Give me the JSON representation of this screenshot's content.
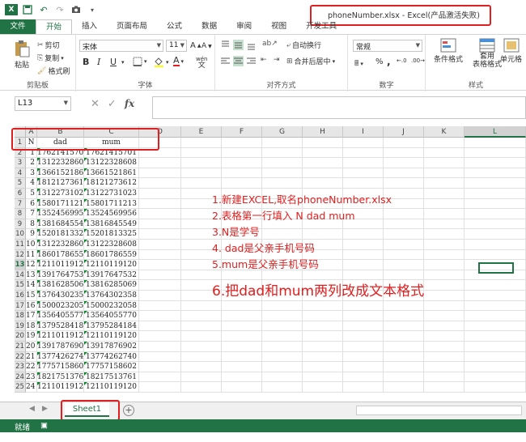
{
  "window": {
    "title": "phoneNumber.xlsx - Excel(产品激活失败)"
  },
  "ribbon_tabs": [
    "文件",
    "开始",
    "插入",
    "页面布局",
    "公式",
    "数据",
    "审阅",
    "视图",
    "开发工具"
  ],
  "ribbon": {
    "clipboard": {
      "paste": "粘贴",
      "cut": "剪切",
      "copy": "复制",
      "format_painter": "格式刷",
      "label": "剪贴板"
    },
    "font": {
      "name": "宋体",
      "size": "11",
      "bold": "B",
      "italic": "I",
      "underline": "U",
      "label": "字体",
      "wen": "wén",
      "wen_char": "文"
    },
    "align": {
      "wrap": "自动换行",
      "merge": "合并后居中",
      "label": "对齐方式"
    },
    "number": {
      "format": "常规",
      "percent": "%",
      "comma": ",",
      "label": "数字"
    },
    "styles": {
      "conditional": "条件格式",
      "table1": "套用",
      "table2": "表格格式",
      "cell": "单元格",
      "label": "样式"
    }
  },
  "formula_bar": {
    "name_box": "L13",
    "fx": "fx",
    "cancel": "✕",
    "confirm": "✓"
  },
  "columns": [
    "A",
    "B",
    "C",
    "D",
    "E",
    "F",
    "G",
    "H",
    "I",
    "J",
    "K",
    "L"
  ],
  "header_row": [
    "N",
    "dad",
    "mum"
  ],
  "rows": [
    [
      1,
      "17621415701",
      "17621415701"
    ],
    [
      2,
      "13122328608",
      "13122328608"
    ],
    [
      3,
      "13661521861",
      "13661521861"
    ],
    [
      4,
      "18121273612",
      "18121273612"
    ],
    [
      5,
      "13122731023",
      "13122731023"
    ],
    [
      6,
      "15801711213",
      "15801711213"
    ],
    [
      7,
      "13524569956",
      "13524569956"
    ],
    [
      8,
      "13816845549",
      "13816845549"
    ],
    [
      9,
      "15201813325",
      "15201813325"
    ],
    [
      10,
      "13122328608",
      "13122328608"
    ],
    [
      11,
      "18601786559",
      "18601786559"
    ],
    [
      12,
      "12110119120",
      "12110119120"
    ],
    [
      13,
      "13917647532",
      "13917647532"
    ],
    [
      14,
      "13816285069",
      "13816285069"
    ],
    [
      15,
      "13764302358",
      "13764302358"
    ],
    [
      16,
      "15000232058",
      "15000232058"
    ],
    [
      17,
      "13564055770",
      "13564055770"
    ],
    [
      18,
      "13795284184",
      "13795284184"
    ],
    [
      19,
      "12110119120",
      "12110119120"
    ],
    [
      20,
      "13917876902",
      "13917876902"
    ],
    [
      21,
      "13774262740",
      "13774262740"
    ],
    [
      22,
      "17757158602",
      "17757158602"
    ],
    [
      23,
      "18217513761",
      "18217513761"
    ],
    [
      24,
      "12110119120",
      "12110119120"
    ]
  ],
  "row_numbers": [
    "1",
    "2",
    "3",
    "4",
    "5",
    "6",
    "7",
    "8",
    "9",
    "10",
    "11",
    "12",
    "13",
    "14",
    "15",
    "16",
    "17",
    "18",
    "19",
    "20",
    "21",
    "22",
    "23",
    "24",
    "25"
  ],
  "annotations": [
    "1.新建EXCEL,取名phoneNumber.xlsx",
    "2.表格第一行填入 N  dad  mum",
    "3.N是学号",
    "4. dad是父亲手机号码",
    "5.mum是父亲手机号码",
    "6.把dad和mum两列改成文本格式"
  ],
  "sheet": {
    "tab": "Sheet1",
    "add": "+",
    "prev": "◀",
    "next": "▶"
  },
  "status": {
    "ready": "就绪"
  },
  "colors": {
    "excel_green": "#217346",
    "annotation_red": "#e02020"
  }
}
